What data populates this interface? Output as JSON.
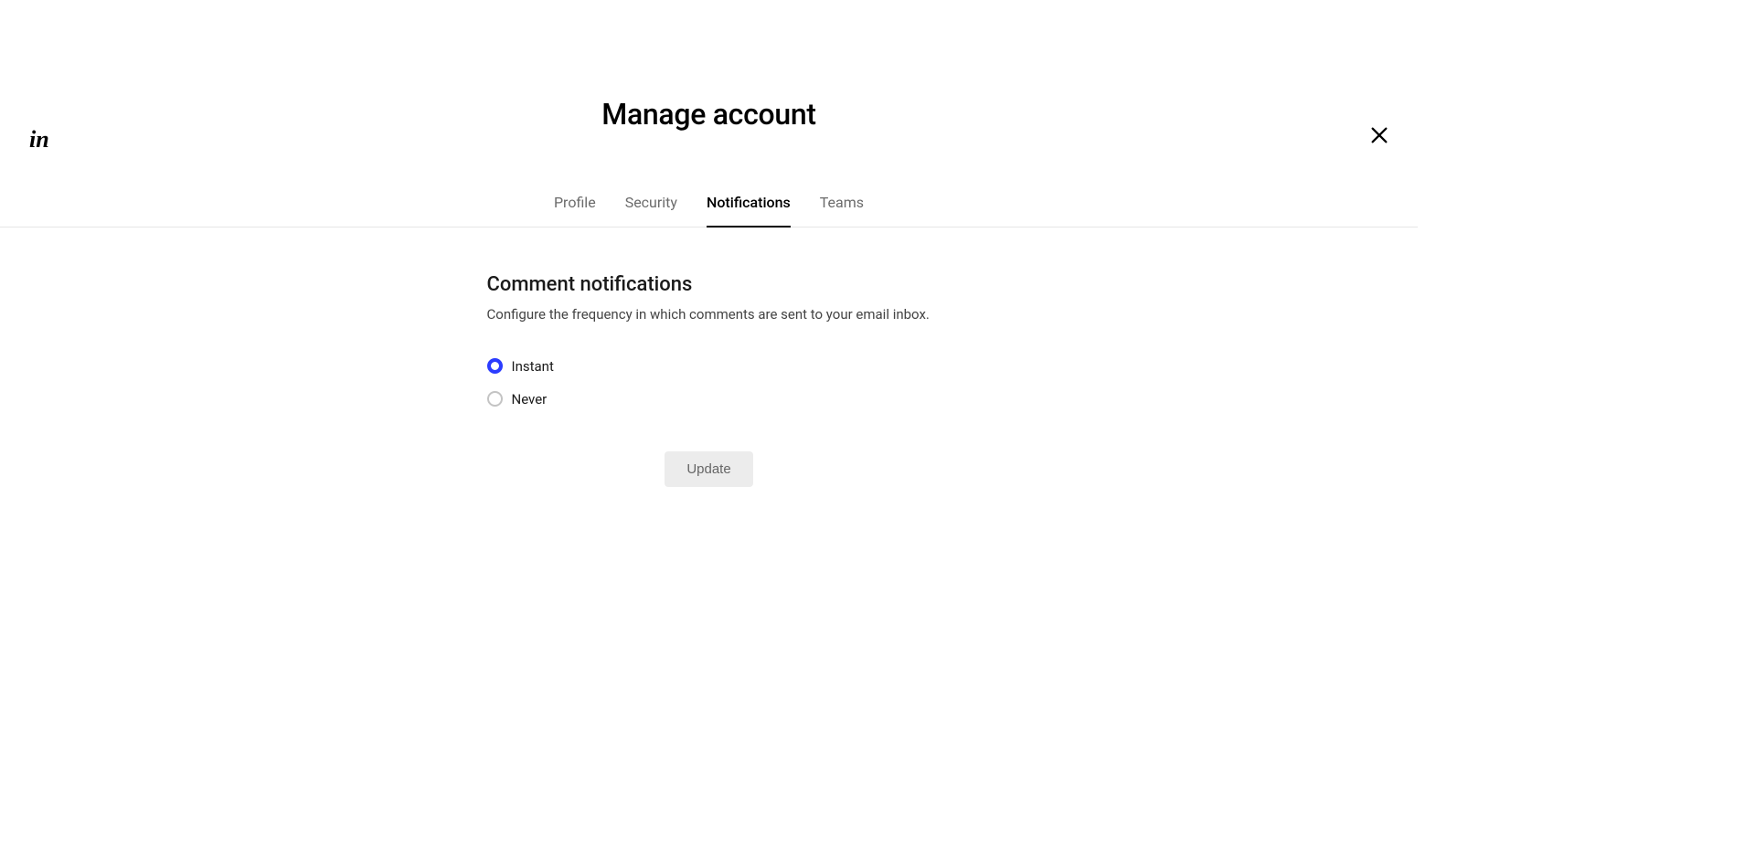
{
  "logo_text": "in",
  "page_title": "Manage account",
  "tabs": {
    "profile": "Profile",
    "security": "Security",
    "notifications": "Notifications",
    "teams": "Teams"
  },
  "section": {
    "title": "Comment notifications",
    "description": "Configure the frequency in which comments are sent to your email inbox."
  },
  "radio_options": {
    "instant": "Instant",
    "never": "Never"
  },
  "update_button": "Update"
}
